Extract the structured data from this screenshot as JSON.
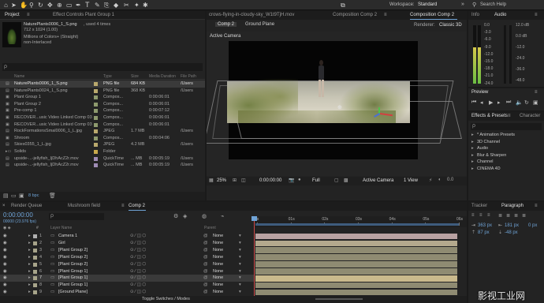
{
  "toolbar": {
    "home_icon": "home-icon",
    "workspace_label": "Workspace:",
    "workspace_value": "Standard",
    "search_label": "Search Help"
  },
  "project_panel": {
    "tab_project": "Project",
    "tab_effect_controls": "Effect Controls Plant Group 1",
    "asset_name": "NaturePlants0006_1_S.png",
    "asset_used": ", used 4 times",
    "asset_dims": "712 x 1024 (1.00)",
    "asset_colors": "Millions of Colors+ (Straight)",
    "asset_interlace": "non-Interlaced",
    "search_placeholder": "ρ",
    "columns": [
      "Name",
      "Type",
      "Size",
      "Media Duration",
      "File Path"
    ],
    "items": [
      {
        "name": "NaturePlants0006_1_S.png",
        "type": "PNG file",
        "size": "684 KB",
        "duration": "",
        "path": "/Users",
        "color": "#b9a96d",
        "kind": "file",
        "selected": true
      },
      {
        "name": "NaturePlants0024_1_S.png",
        "type": "PNG file",
        "size": "368 KB",
        "duration": "",
        "path": "/Users",
        "color": "#b9a96d",
        "kind": "file",
        "selected": false
      },
      {
        "name": "Plant Group 1",
        "type": "Compos...",
        "size": "",
        "duration": "0:00:06:01",
        "path": "",
        "color": "#8e9a6e",
        "kind": "comp",
        "selected": false
      },
      {
        "name": "Plant Group 2",
        "type": "Compos...",
        "size": "",
        "duration": "0:00:06:01",
        "path": "",
        "color": "#8e9a6e",
        "kind": "comp",
        "selected": false
      },
      {
        "name": "Pre-comp 1",
        "type": "Compos...",
        "size": "",
        "duration": "0:00:07:12",
        "path": "",
        "color": "#8e9a6e",
        "kind": "comp",
        "selected": false
      },
      {
        "name": "RECOVER...usic Video Linked Comp 03",
        "type": "Compos...",
        "size": "",
        "duration": "0:00:06:01",
        "path": "",
        "color": "#8e9a6e",
        "kind": "comp",
        "selected": false
      },
      {
        "name": "RECOVER...usic Video Linked Comp 03",
        "type": "Compos...",
        "size": "",
        "duration": "0:00:06:01",
        "path": "",
        "color": "#8e9a6e",
        "kind": "comp",
        "selected": false
      },
      {
        "name": "RockFormationsSmal0006_1_L.jpg",
        "type": "JPEG",
        "size": "1.7 MB",
        "duration": "",
        "path": "/Users",
        "color": "#b9a96d",
        "kind": "file",
        "selected": false
      },
      {
        "name": "Shroom",
        "type": "Compos...",
        "size": "",
        "duration": "0:00:04:06",
        "path": "",
        "color": "#8e9a6e",
        "kind": "comp",
        "selected": false
      },
      {
        "name": "Skies0355_1_L.jpg",
        "type": "JPEG",
        "size": "4.2 MB",
        "duration": "",
        "path": "/Users",
        "color": "#b9a96d",
        "kind": "file",
        "selected": false
      },
      {
        "name": "Solids",
        "type": "Folder",
        "size": "",
        "duration": "",
        "path": "",
        "color": "#c8a94c",
        "kind": "folder",
        "selected": false
      },
      {
        "name": "upside-...-jellyfish_IjDhAcZ2r.mov",
        "type": "QuickTime",
        "size": "... MB",
        "duration": "0:00:05:19",
        "path": "/Users",
        "color": "#9f8cb5",
        "kind": "file",
        "selected": false
      },
      {
        "name": "upside-...-jellyfish_IjDhAcZ2r.mov",
        "type": "QuickTime",
        "size": "... MB",
        "duration": "0:00:05:19",
        "path": "/Users",
        "color": "#9f8cb5",
        "kind": "file",
        "selected": false
      }
    ],
    "footer_bpc": "8 bpc"
  },
  "viewer": {
    "tab_footage": "crows-flying-in-cloudy-sky_W1t9TjH.mov",
    "tab_comp2": "Composition Comp 2",
    "tab_comp_active": "Composition Comp 2",
    "breadcrumb_1": "Comp 2",
    "breadcrumb_2": "Ground Plane",
    "renderer_label": "Renderer:",
    "renderer_value": "Classic 3D",
    "camera_label": "Active Camera",
    "footer": {
      "zoom": "25%",
      "timecode": "0:00:00:00",
      "resolution": "Full",
      "camera": "Active Camera",
      "views": "1 View"
    }
  },
  "info_panel": {
    "tab_info": "Info",
    "tab_audio": "Audio",
    "db_left": [
      "0.0",
      "-3.0",
      "-6.0",
      "-9.0",
      "-12.0",
      "-15.0",
      "-18.0",
      "-21.0",
      "-24.0"
    ],
    "db_right": [
      "12.0 dB",
      "0.0 dB",
      "-12.0",
      "-24.0",
      "-36.0",
      "-48.0"
    ],
    "meter_level": 0.62
  },
  "preview_panel": {
    "title": "Preview"
  },
  "effects_panel": {
    "tab_effects": "Effects & Presets",
    "tab_character": "Character",
    "search_placeholder": "ρ",
    "items": [
      "* Animation Presets",
      "3D Channel",
      "Audio",
      "Blur & Sharpen",
      "Channel",
      "CINEMA 4D"
    ]
  },
  "paragraph_panel": {
    "tab_tracker": "Tracker",
    "tab_paragraph": "Paragraph",
    "indent_left": "363 px",
    "indent_right": "181 px",
    "indent_first": "0 px",
    "space_before": "87 px",
    "space_after": "-48 px"
  },
  "timeline": {
    "tab_render": "Render Queue",
    "tab_mushroom": "Mushroom field",
    "tab_comp2": "Comp 2",
    "timecode": "0:00:00:00",
    "timecode_sub": "00000 (23.976 fps)",
    "search_placeholder": "ρ",
    "col_layer_name": "Layer Name",
    "col_parent": "Parent",
    "ruler": [
      "0s",
      "01s",
      "02s",
      "03s",
      "04s",
      "05s",
      "06s"
    ],
    "layers": [
      {
        "num": "1",
        "name": "Camera 1",
        "parent": "None",
        "color": "#b0b0b0",
        "bar": "#b9a2a2",
        "selected": false
      },
      {
        "num": "2",
        "name": "Girl",
        "parent": "None",
        "color": "#a7a48a",
        "bar": "#b4a98d",
        "selected": false
      },
      {
        "num": "3",
        "name": "[Plant Group 2]",
        "parent": "None",
        "color": "#a7a48a",
        "bar": "#8f8b72",
        "selected": false
      },
      {
        "num": "4",
        "name": "[Plant Group 2]",
        "parent": "None",
        "color": "#a7a48a",
        "bar": "#8f8b72",
        "selected": false
      },
      {
        "num": "5",
        "name": "[Plant Group 2]",
        "parent": "None",
        "color": "#a7a48a",
        "bar": "#8f8b72",
        "selected": false
      },
      {
        "num": "6",
        "name": "[Plant Group 1]",
        "parent": "None",
        "color": "#a7a48a",
        "bar": "#8f8b72",
        "selected": false
      },
      {
        "num": "7",
        "name": "[Plant Group 1]",
        "parent": "None",
        "color": "#a7a48a",
        "bar": "#c9b98c",
        "selected": true
      },
      {
        "num": "8",
        "name": "[Plant Group 1]",
        "parent": "None",
        "color": "#a7a48a",
        "bar": "#8f8b72",
        "selected": false
      },
      {
        "num": "9",
        "name": "[Ground Plane]",
        "parent": "None",
        "color": "#a7a48a",
        "bar": "#8f8b72",
        "selected": false
      }
    ],
    "footer_toggle": "Toggle Switches / Modes"
  },
  "watermark": "影视工业网"
}
